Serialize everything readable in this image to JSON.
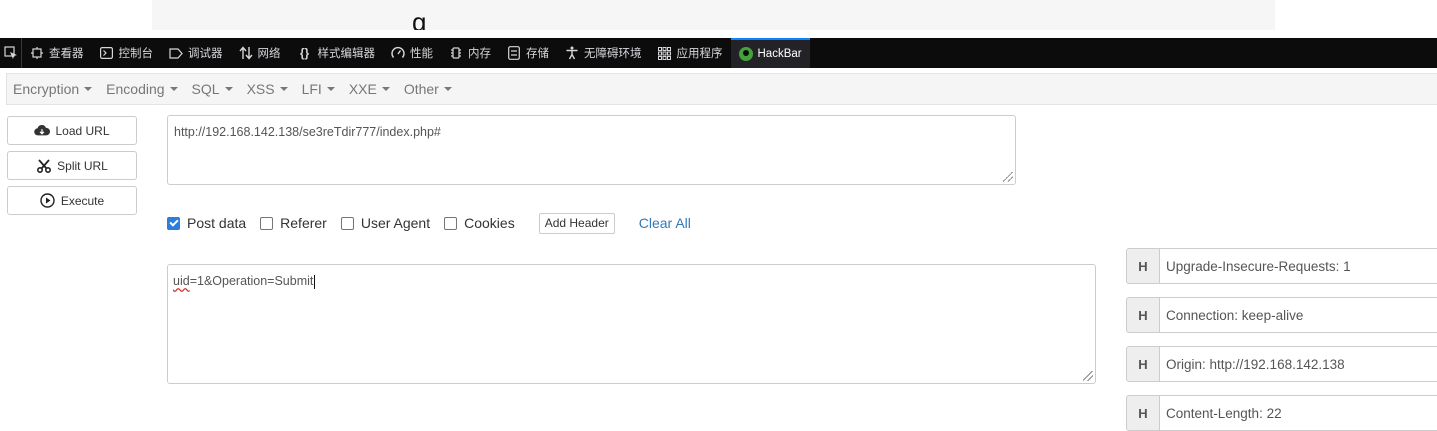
{
  "page_strip": {
    "partial_glyph": "g"
  },
  "devtools": {
    "tabs": [
      {
        "label": "查看器",
        "icon": "inspector-icon"
      },
      {
        "label": "控制台",
        "icon": "console-icon"
      },
      {
        "label": "调试器",
        "icon": "debugger-icon"
      },
      {
        "label": "网络",
        "icon": "network-icon"
      },
      {
        "label": "样式编辑器",
        "icon": "style-editor-icon"
      },
      {
        "label": "性能",
        "icon": "performance-icon"
      },
      {
        "label": "内存",
        "icon": "memory-icon"
      },
      {
        "label": "存储",
        "icon": "storage-icon"
      },
      {
        "label": "无障碍环境",
        "icon": "accessibility-icon"
      },
      {
        "label": "应用程序",
        "icon": "application-icon"
      },
      {
        "label": "HackBar",
        "icon": "hackbar-logo-icon",
        "active": true
      }
    ],
    "accent_color": "#0a84ff"
  },
  "menu": {
    "items": [
      "Encryption",
      "Encoding",
      "SQL",
      "XSS",
      "LFI",
      "XXE",
      "Other"
    ]
  },
  "actions": {
    "load_url": "Load URL",
    "split_url": "Split URL",
    "execute": "Execute"
  },
  "url_field": {
    "value": "http://192.168.142.138/se3reTdir777/index.php#"
  },
  "options": {
    "post_data": {
      "label": "Post data",
      "checked": true
    },
    "referer": {
      "label": "Referer",
      "checked": false
    },
    "user_agent": {
      "label": "User Agent",
      "checked": false
    },
    "cookies": {
      "label": "Cookies",
      "checked": false
    },
    "add_header": "Add Header",
    "clear_all": "Clear All"
  },
  "post_field": {
    "value_misspelled": "uid",
    "value_rest": "=1&Operation=Submit"
  },
  "headers": [
    {
      "tag": "H",
      "value": "Upgrade-Insecure-Requests: 1"
    },
    {
      "tag": "H",
      "value": "Connection: keep-alive"
    },
    {
      "tag": "H",
      "value": "Origin: http://192.168.142.138"
    },
    {
      "tag": "H",
      "value": "Content-Length: 22"
    }
  ]
}
